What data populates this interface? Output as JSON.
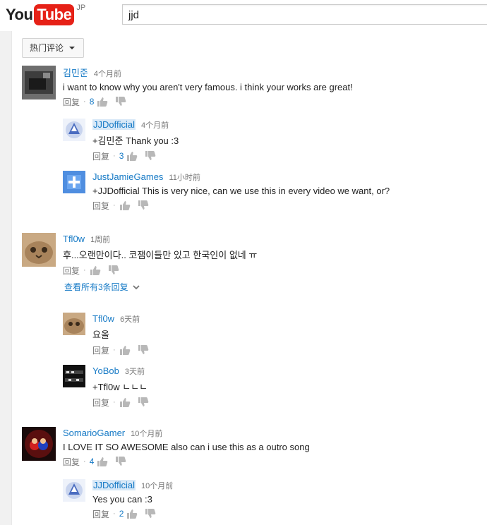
{
  "header": {
    "logo_you": "You",
    "logo_tube": "Tube",
    "logo_region": "JP",
    "search_value": "jjd"
  },
  "sort": {
    "label": "热门评论"
  },
  "reply_label": "回复",
  "view_replies": "查看所有3条回复",
  "comments": [
    {
      "author": "김민준",
      "time": "4个月前",
      "text": "i want to know why you aren't very famous. i think your works are great!",
      "likes": "8"
    },
    {
      "author": "JJDofficial",
      "time": "4个月前",
      "text": "+김민준 Thank you :3",
      "likes": "3"
    },
    {
      "author": "JustJamieGames",
      "time": "11小时前",
      "text": "+JJDofficial This is very nice, can we use this in every video we want, or?",
      "likes": ""
    },
    {
      "author": "Tfl0w",
      "time": "1周前",
      "text": "후...오랜만이다.. 코잼이들만 있고 한국인이 없네 ㅠ",
      "likes": ""
    },
    {
      "author": "Tfl0w",
      "time": "6天前",
      "text": "요올",
      "likes": ""
    },
    {
      "author": "YoBob",
      "time": "3天前",
      "text": "+Tfl0w ㄴㄴㄴ",
      "likes": ""
    },
    {
      "author": "SomarioGamer",
      "time": "10个月前",
      "text": "I LOVE IT SO AWESOME also can i use this as a outro song",
      "likes": "4"
    },
    {
      "author": "JJDofficial",
      "time": "10个月前",
      "text": "Yes you can :3",
      "likes": "2"
    }
  ]
}
